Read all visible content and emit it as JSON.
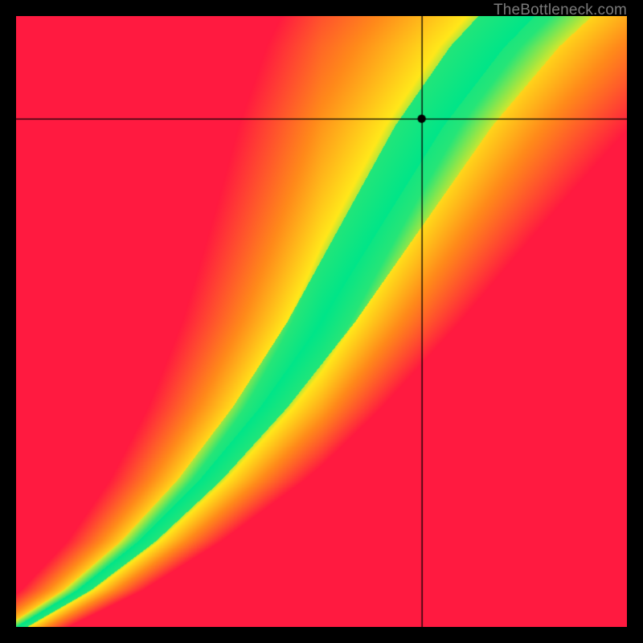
{
  "watermark": "TheBottleneck.com",
  "chart_data": {
    "type": "heatmap",
    "title": "",
    "xlabel": "",
    "ylabel": "",
    "xlim": [
      0,
      1
    ],
    "ylim": [
      0,
      1
    ],
    "crosshair": {
      "x": 0.664,
      "y": 0.832
    },
    "marker": {
      "x": 0.664,
      "y": 0.832
    },
    "ridge_points": [
      {
        "x": 0.0,
        "y": 0.0
      },
      {
        "x": 0.1,
        "y": 0.06
      },
      {
        "x": 0.2,
        "y": 0.14
      },
      {
        "x": 0.3,
        "y": 0.24
      },
      {
        "x": 0.4,
        "y": 0.36
      },
      {
        "x": 0.5,
        "y": 0.5
      },
      {
        "x": 0.6,
        "y": 0.66
      },
      {
        "x": 0.7,
        "y": 0.82
      },
      {
        "x": 0.8,
        "y": 0.95
      },
      {
        "x": 0.85,
        "y": 1.0
      }
    ],
    "palette": {
      "red": "#ff1a40",
      "orange": "#ff8c1a",
      "yellow": "#ffe81a",
      "green": "#00e589"
    },
    "notes": "Optimal green ridge roughly follows a steeper-than-diagonal S-curve from origin toward upper region. Background grades red→orange→yellow with distance-based falloff from the ridge; far orthogonal regions saturate to red.",
    "pixel_size": 760
  }
}
